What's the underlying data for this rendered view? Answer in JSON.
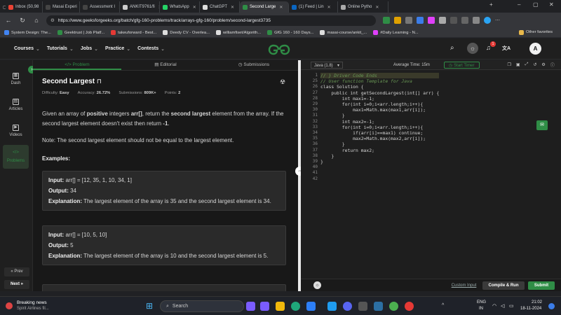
{
  "browser": {
    "tabs": [
      {
        "label": "Inbox (50,98",
        "color": "#ea4335"
      },
      {
        "label": "Masai Experi",
        "color": "#444"
      },
      {
        "label": "Assessment I",
        "color": "#444"
      },
      {
        "label": "ANKIT9761/fi",
        "color": "#ccc"
      },
      {
        "label": "WhatsApp",
        "color": "#25d366"
      },
      {
        "label": "ChatGPT",
        "color": "#ddd"
      },
      {
        "label": "Second Large",
        "color": "#2f8d46",
        "active": true
      },
      {
        "label": "(1) Feed | Lin",
        "color": "#0a66c2"
      },
      {
        "label": "Online Pytho",
        "color": "#aaa"
      }
    ],
    "url": "https://www.geeksforgeeks.org/batch/gfg-160-problems/track/arrays-gfg-160/problem/second-largest3735",
    "bookmarks": [
      {
        "label": "System Design: The...",
        "color": "#4285f4"
      },
      {
        "label": "Geektrust | Job Platf...",
        "color": "#2f8d46"
      },
      {
        "label": "takeuforward - Best...",
        "color": "#e53935"
      },
      {
        "label": "Deedy CV - Overlea...",
        "color": "#ddd"
      },
      {
        "label": "williamfiset/Algorith...",
        "color": "#ddd"
      },
      {
        "label": "GfG 160 - 160 Days...",
        "color": "#2f8d46"
      },
      {
        "label": "masai-course/ankit_...",
        "color": "#ddd"
      },
      {
        "label": "#Daily Learning - N...",
        "color": "#e040fb"
      }
    ],
    "other_bookmarks": "Other favorites"
  },
  "gfg": {
    "nav": [
      "Courses",
      "Tutorials",
      "Jobs",
      "Practice",
      "Contests"
    ],
    "notification_count": "1",
    "avatar": "A",
    "rail": [
      {
        "label": "Dash",
        "icon": "dashboard-icon"
      },
      {
        "label": "Articles",
        "icon": "articles-icon"
      },
      {
        "label": "Videos",
        "icon": "videos-icon"
      },
      {
        "label": "Problems",
        "icon": "code-icon",
        "active": true
      }
    ],
    "prev": "« Prev",
    "next": "Next »"
  },
  "problem": {
    "tabs": [
      "Problem",
      "Editorial",
      "Submissions"
    ],
    "title": "Second Largest",
    "meta": {
      "difficulty_label": "Difficulty:",
      "difficulty": "Easy",
      "accuracy_label": "Accuracy:",
      "accuracy": "26.72%",
      "submissions_label": "Submissions:",
      "submissions": "809K+",
      "points_label": "Points:",
      "points": "2"
    },
    "desc_1": "Given an array of ",
    "desc_positive": "positive",
    "desc_2": " integers ",
    "desc_arr": "arr[]",
    "desc_3": ", return the ",
    "desc_second": "second largest",
    "desc_4": " element from the array. If the second largest element doesn't exist then return ",
    "desc_neg": "-1",
    "desc_5": ".",
    "note": "Note: The second largest element should not be equal to the largest element.",
    "examples_heading": "Examples:",
    "examples": [
      {
        "input": "arr[] = [12, 35, 1, 10, 34, 1]",
        "output": "34",
        "explanation": "The largest element of the array is 35 and the second largest element is 34."
      },
      {
        "input": "arr[] = [10, 5, 10]",
        "output": "5",
        "explanation": "The largest element of the array is 10 and the second largest element is 5."
      }
    ],
    "input_label": "Input:",
    "output_label": "Output:",
    "explanation_label": "Explanation:"
  },
  "editor": {
    "language": "Java (1.8)",
    "average_time": "Average Time: 15m",
    "start_timer": "Start Timer",
    "line_numbers": [
      "1",
      "25",
      "26",
      "27",
      "28",
      "29",
      "30",
      "31",
      "32",
      "33",
      "34",
      "35",
      "36",
      "37",
      "38",
      "39",
      "40",
      "41",
      "42"
    ],
    "code_lines": [
      "// } Driver Code Ends",
      "",
      "",
      "// User function Template for Java",
      "",
      "class Solution {",
      "    public int getSecondLargest(int[] arr) {",
      "        int max1=-1;",
      "        for(int i=0;i<arr.length;i++){",
      "            max1=Math.max(max1,arr[i]);",
      "        }",
      "        int max2=-1;",
      "        for(int i=0;i<arr.length;i++){",
      "            if(arr[i]==max1) continue;",
      "            max2=Math.max(max2,arr[i]);",
      "        }",
      "        return max2;",
      "    }",
      "}"
    ],
    "custom_input": "Custom Input",
    "compile_run": "Compile & Run",
    "submit": "Submit"
  },
  "taskbar": {
    "news_title": "Breaking news",
    "news_sub": "Spirit Airlines fil...",
    "search_placeholder": "Search",
    "lang_1": "ENG",
    "lang_2": "IN",
    "time": "21:02",
    "date": "18-11-2024"
  }
}
